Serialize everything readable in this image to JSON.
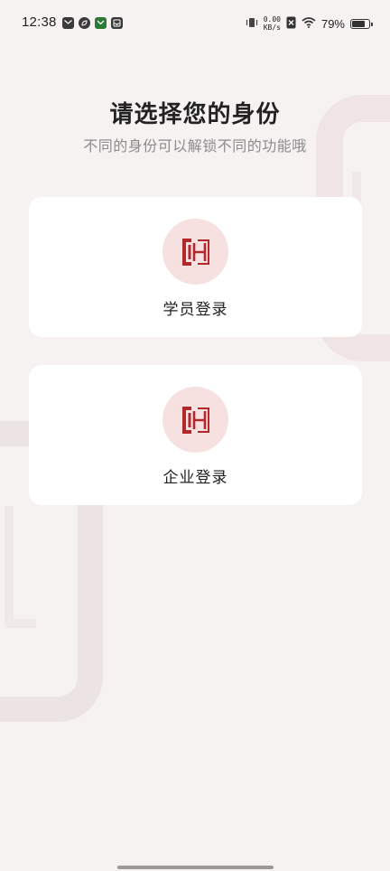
{
  "status_bar": {
    "time": "12:38",
    "net_speed_value": "0.00",
    "net_speed_unit": "KB/s",
    "battery_percent": "79%",
    "battery_level": 0.79,
    "notification_icons": [
      "mail-icon",
      "leaf-app-icon",
      "wechat-icon",
      "inbox-icon"
    ]
  },
  "header": {
    "title": "请选择您的身份",
    "subtitle": "不同的身份可以解锁不同的功能哦"
  },
  "options": [
    {
      "label": "学员登录",
      "icon": "logo-icon"
    },
    {
      "label": "企业登录",
      "icon": "logo-icon"
    }
  ],
  "colors": {
    "accent": "#b3282d",
    "icon_bg": "#f6e0e0",
    "background": "#f6f2f2"
  }
}
